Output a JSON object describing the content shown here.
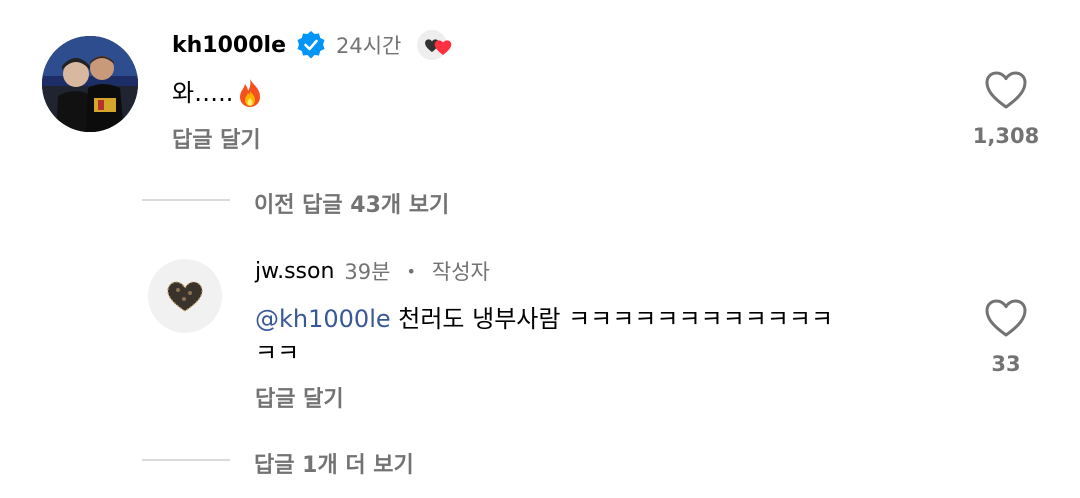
{
  "comment": {
    "username": "kh1000le",
    "time": "24시간",
    "text": "와…..",
    "reply_label": "답글 달기",
    "like_count": "1,308"
  },
  "view_previous": "이전 답글 43개 보기",
  "reply": {
    "username": "jw.sson",
    "time": "39분",
    "separator": "•",
    "author_badge": "작성자",
    "mention": "@kh1000le",
    "text_line1": " 천러도 냉부사람 ㅋㅋㅋㅋㅋㅋㅋㅋㅋㅋㅋㅋ",
    "text_line2": "ㅋㅋ",
    "reply_label": "답글 달기",
    "like_count": "33"
  },
  "view_more": "답글 1개 더 보기",
  "colors": {
    "verified": "#0095f6",
    "mention": "#385898",
    "muted": "#737373",
    "heart_badge": "#ff3040"
  }
}
